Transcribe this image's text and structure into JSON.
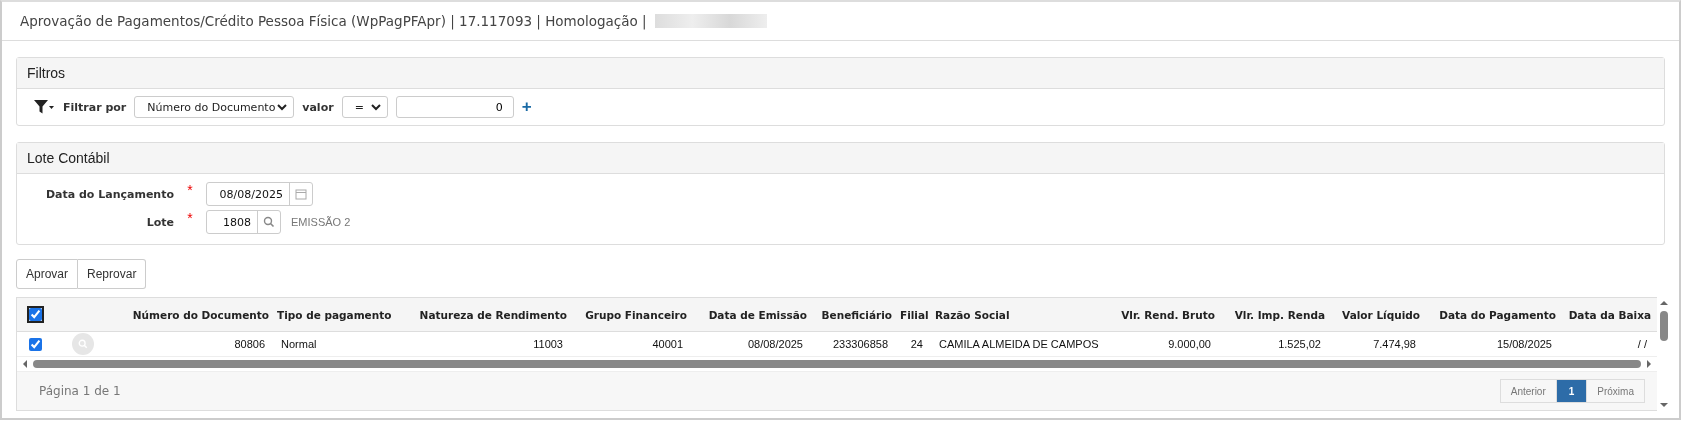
{
  "window": {
    "title": "Aprovação de Pagamentos/Crédito Pessoa Física (WpPagPFApr) | 17.117093 | Homologação |"
  },
  "filters": {
    "title": "Filtros",
    "label": "Filtrar por",
    "field": "Número do Documento",
    "value_label": "valor",
    "operator": "=",
    "value": "0",
    "add": "+"
  },
  "lote": {
    "title": "Lote Contábil",
    "fields": [
      {
        "kind": "date",
        "label": "Data do Lançamento",
        "required_mark": "*",
        "value": "08/08/2025"
      },
      {
        "kind": "lookup",
        "label": "Lote",
        "required_mark": "*",
        "value": "1808",
        "description": "EMISSÃO 2"
      }
    ]
  },
  "actions": [
    "Aprovar",
    "Reprovar"
  ],
  "table": {
    "select_all": true,
    "columns": [
      {
        "label": "Número do Documento"
      },
      {
        "label": "Tipo de pagamento"
      },
      {
        "label": "Natureza de Rendimento"
      },
      {
        "label": "Grupo Financeiro"
      },
      {
        "label": "Data de Emissão"
      },
      {
        "label": "Beneficiário"
      },
      {
        "label": "Filial"
      },
      {
        "label": "Razão Social"
      },
      {
        "label": "Vlr. Rend. Bruto"
      },
      {
        "label": "Vlr. Imp. Renda"
      },
      {
        "label": "Valor Líquido"
      },
      {
        "label": "Data do Pagamento"
      },
      {
        "label": "Data da Baixa"
      }
    ],
    "rows": [
      {
        "selected": true,
        "cells": [
          "80806",
          "Normal",
          "11003",
          "40001",
          "08/08/2025",
          "233306858",
          "24",
          "CAMILA ALMEIDA DE CAMPOS",
          "9.000,00",
          "1.525,02",
          "7.474,98",
          "15/08/2025",
          "/ /"
        ]
      }
    ]
  },
  "pagination": {
    "text": "Página 1 de 1",
    "previous": "Anterior",
    "pages": [
      {
        "label": "1",
        "selected": true
      }
    ],
    "next": "Próxima"
  }
}
